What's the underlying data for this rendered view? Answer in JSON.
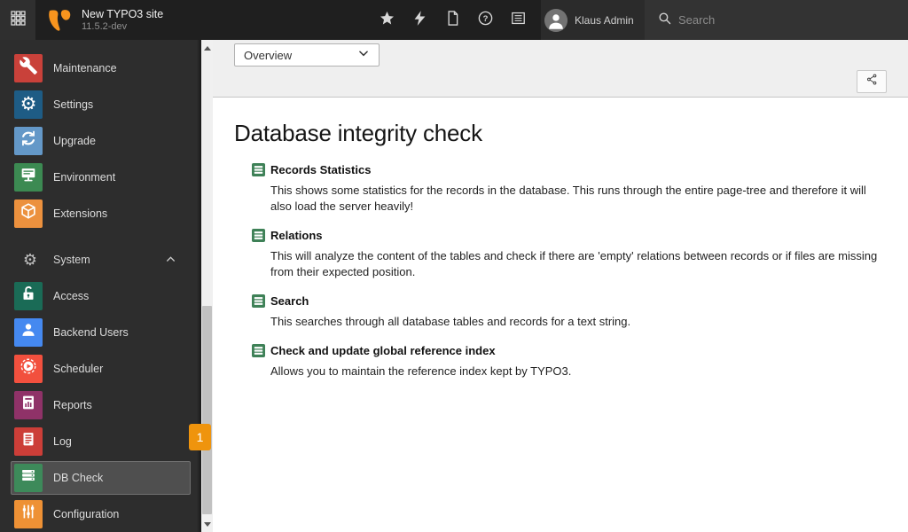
{
  "topbar": {
    "modules_button": {
      "icon": "app-grid-icon"
    },
    "site_title": "New TYPO3 site",
    "site_version": "11.5.2-dev",
    "logo_color": "#f7941e",
    "icons": [
      {
        "name": "bookmark-star-icon"
      },
      {
        "name": "clear-cache-bolt-icon"
      },
      {
        "name": "new-document-icon"
      },
      {
        "name": "help-icon"
      },
      {
        "name": "opened-documents-icon"
      }
    ],
    "user": {
      "name": "Klaus Admin",
      "icon": "avatar-icon"
    },
    "search": {
      "placeholder": "Search",
      "icon": "search-icon"
    }
  },
  "sidebar": {
    "top_items": [
      {
        "label": "Maintenance",
        "color": "#c9413a",
        "icon": "wrench-icon"
      },
      {
        "label": "Settings",
        "color": "#1e5c85",
        "icon": "gear-icon"
      },
      {
        "label": "Upgrade",
        "color": "#6498c8",
        "icon": "refresh-icon"
      },
      {
        "label": "Environment",
        "color": "#3c8a52",
        "icon": "monitor-icon"
      },
      {
        "label": "Extensions",
        "color": "#ec913e",
        "icon": "cube-icon"
      }
    ],
    "section": {
      "label": "System",
      "icon": "gear-outline-icon",
      "state_icon": "chevron-up-icon"
    },
    "system_items": [
      {
        "label": "Access",
        "color": "#1a6b56",
        "icon": "unlock-icon"
      },
      {
        "label": "Backend Users",
        "color": "#4589f0",
        "icon": "person-icon"
      },
      {
        "label": "Scheduler",
        "color": "#f2503e",
        "icon": "play-circle-icon"
      },
      {
        "label": "Reports",
        "color": "#8f3268",
        "icon": "chart-document-icon"
      },
      {
        "label": "Log",
        "color": "#cc3e38",
        "icon": "list-document-icon"
      },
      {
        "label": "DB Check",
        "color": "#3d8a5a",
        "icon": "database-icon",
        "selected": true,
        "badge": "1",
        "badge_color": "#ef940d"
      },
      {
        "label": "Configuration",
        "color": "#ee9135",
        "icon": "sliders-icon"
      }
    ]
  },
  "docheader": {
    "function_select": {
      "value": "Overview",
      "icon": "chevron-down-icon"
    },
    "share_button": {
      "icon": "share-icon"
    }
  },
  "main": {
    "title": "Database integrity check",
    "item_icon": "database-icon",
    "item_icon_color": "#3e8157",
    "items": [
      {
        "title": "Records Statistics",
        "description": "This shows some statistics for the records in the database. This runs through the entire page-tree and therefore it will also load the server heavily!"
      },
      {
        "title": "Relations",
        "description": "This will analyze the content of the tables and check if there are 'empty' relations between records or if files are missing from their expected position."
      },
      {
        "title": "Search",
        "description": "This searches through all database tables and records for a text string."
      },
      {
        "title": "Check and update global reference index",
        "description": "Allows you to maintain the reference index kept by TYPO3."
      }
    ]
  }
}
